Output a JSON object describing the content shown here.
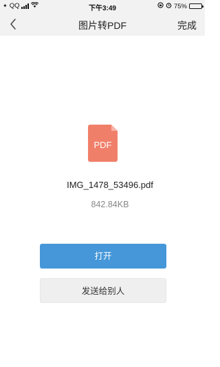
{
  "status_bar": {
    "carrier": "QQ",
    "time": "下午3:49",
    "battery_percent": "75%",
    "battery_level": 0.75
  },
  "nav": {
    "back_icon": "chevron-left-icon",
    "title": "图片转PDF",
    "done_label": "完成"
  },
  "file": {
    "icon": "pdf-file-icon",
    "icon_label": "PDF",
    "icon_color": "#f07f6a",
    "name": "IMG_1478_53496.pdf",
    "size": "842.84KB"
  },
  "actions": {
    "open_label": "打开",
    "send_label": "发送给别人",
    "primary_color": "#4597d9"
  }
}
